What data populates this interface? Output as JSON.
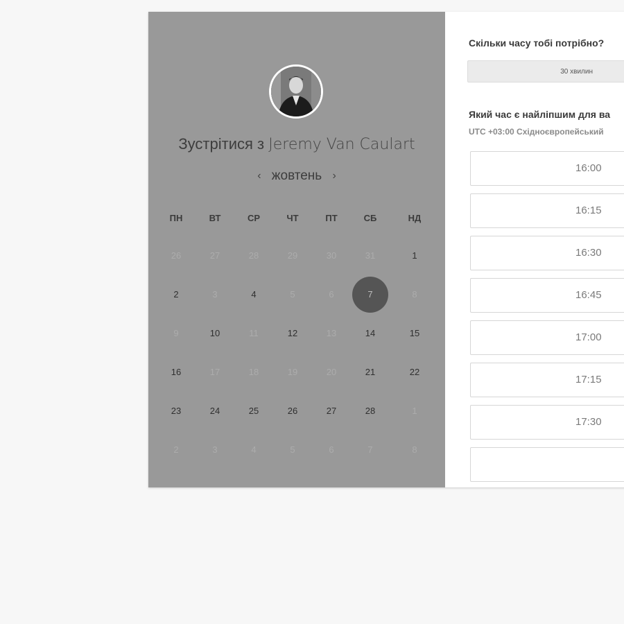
{
  "booking": {
    "title_prefix": "Зустрітися з",
    "host_name": "Jeremy Van Caulart",
    "month": "жовтень",
    "prev_symbol": "‹",
    "next_symbol": "›"
  },
  "weekdays": [
    "ПН",
    "ВТ",
    "СР",
    "ЧТ",
    "ПТ",
    "СБ",
    "НД"
  ],
  "days": [
    [
      "26",
      "27",
      "28",
      "29",
      "30",
      "31",
      "1"
    ],
    [
      "2",
      "3",
      "4",
      "5",
      "6",
      "7",
      "8"
    ],
    [
      "9",
      "10",
      "11",
      "12",
      "13",
      "14",
      "15"
    ],
    [
      "16",
      "17",
      "18",
      "19",
      "20",
      "21",
      "22"
    ],
    [
      "23",
      "24",
      "25",
      "26",
      "27",
      "28",
      "1"
    ],
    [
      "2",
      "3",
      "4",
      "5",
      "6",
      "7",
      "8"
    ]
  ],
  "available_days": [
    [
      6
    ],
    [
      0,
      2
    ],
    [
      1,
      3,
      5,
      6
    ],
    [
      0,
      5,
      6
    ],
    [
      0,
      1,
      2,
      3,
      4,
      5
    ],
    []
  ],
  "selected_day": [
    1,
    5
  ],
  "duration": {
    "question": "Скільки часу тобі потрібно?",
    "value": "30 хвилин"
  },
  "time": {
    "question": "Який час є найліпшим для ва",
    "timezone": "UTC +03:00 Східноєвропейський"
  },
  "slots": [
    "16:00",
    "16:15",
    "16:30",
    "16:45",
    "17:00",
    "17:15",
    "17:30",
    ""
  ],
  "colors": {
    "left_panel": "#999999",
    "selected_day": "#555555",
    "page_bg": "#f7f7f7"
  }
}
